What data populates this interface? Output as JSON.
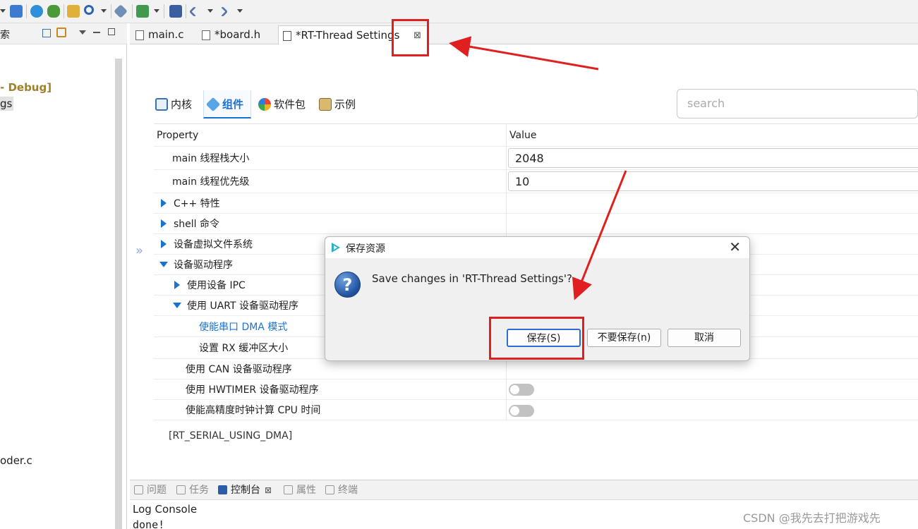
{
  "left_pane": {
    "header_text": "索",
    "items": [
      {
        "label": "- Debug]"
      },
      {
        "label": "gs"
      },
      {
        "label": "oder.c"
      }
    ]
  },
  "editor_tabs": [
    {
      "label": "main.c",
      "active": false
    },
    {
      "label": "*board.h",
      "active": false
    },
    {
      "label": "*RT-Thread Settings",
      "active": true
    }
  ],
  "close_glyph": "⊠",
  "sub_tabs": [
    {
      "label": "内核",
      "icon": "kernel-grid-icon",
      "active": false
    },
    {
      "label": "组件",
      "icon": "component-cube-icon",
      "active": true
    },
    {
      "label": "软件包",
      "icon": "packages-icon",
      "active": false
    },
    {
      "label": "示例",
      "icon": "example-clipboard-icon",
      "active": false
    }
  ],
  "search": {
    "placeholder": "search"
  },
  "table": {
    "col_property": "Property",
    "col_value": "Value",
    "rows": [
      {
        "label": "main 线程栈大小",
        "value": "2048"
      },
      {
        "label": "main 线程优先级",
        "value": "10"
      },
      {
        "label": "C++ 特性"
      },
      {
        "label": "shell 命令"
      },
      {
        "label": "设备虚拟文件系统"
      },
      {
        "label": "设备驱动程序"
      },
      {
        "label": "使用设备 IPC"
      },
      {
        "label": "使用 UART 设备驱动程序"
      },
      {
        "label": "使能串口 DMA 模式"
      },
      {
        "label": "设置 RX 缓冲区大小"
      },
      {
        "label": "使用 CAN 设备驱动程序"
      },
      {
        "label": "使用 HWTIMER 设备驱动程序"
      },
      {
        "label": "使能高精度时钟计算 CPU 时间"
      }
    ],
    "highlight_color": "#1b73d1"
  },
  "macro_name": "[RT_SERIAL_USING_DMA]",
  "collapse_glyph": "»",
  "console": {
    "tabs": [
      {
        "label": "问题",
        "active": false
      },
      {
        "label": "任务",
        "active": false
      },
      {
        "label": "控制台",
        "active": true
      },
      {
        "label": "属性",
        "active": false
      },
      {
        "label": "终端",
        "active": false
      }
    ],
    "title": "Log Console",
    "output": "done!"
  },
  "dialog": {
    "title": "保存资源",
    "question_glyph": "?",
    "message": "Save changes in 'RT-Thread Settings'?",
    "buttons": {
      "save": "保存(S)",
      "dont_save": "不要保存(n)",
      "cancel": "取消"
    },
    "close_glyph": "✕"
  },
  "annotation_color": "#e02020",
  "watermark": "CSDN @我先去打把游戏先"
}
